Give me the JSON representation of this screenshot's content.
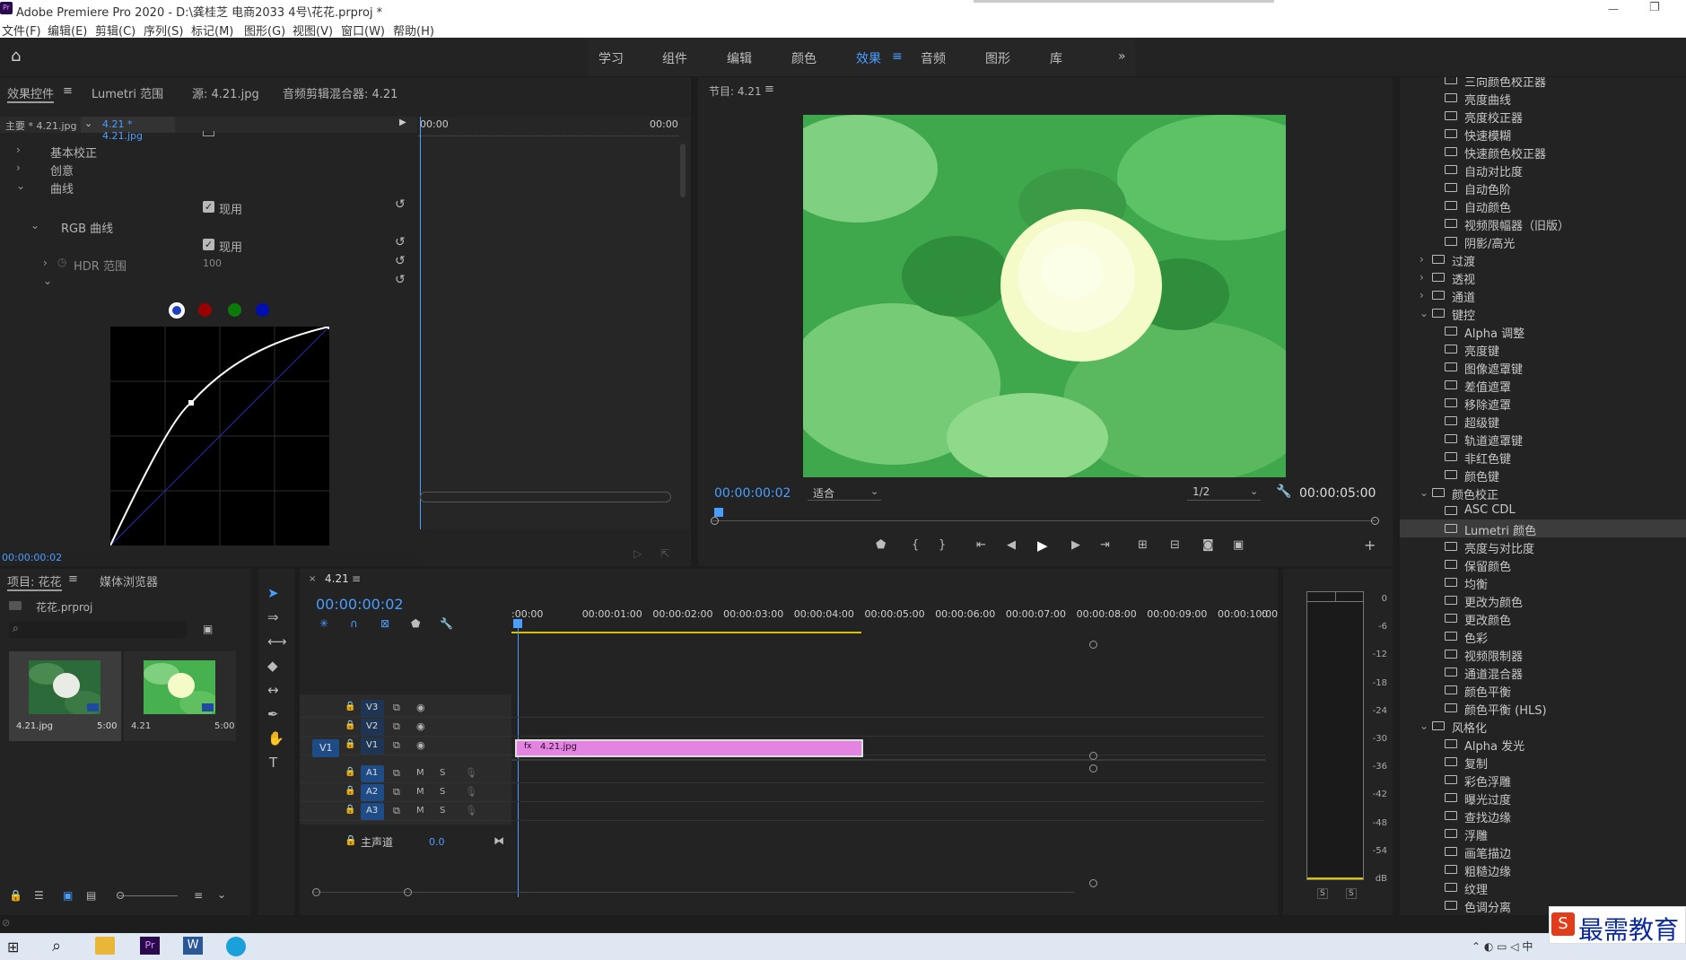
{
  "app": {
    "title": "Adobe Premiere Pro 2020 - D:\\龚桂芝 电商2033 4号\\花花.prproj *",
    "icon": "Pr"
  },
  "menu": [
    "文件(F)",
    "编辑(E)",
    "剪辑(C)",
    "序列(S)",
    "标记(M)",
    "图形(G)",
    "视图(V)",
    "窗口(W)",
    "帮助(H)"
  ],
  "workspaces": {
    "tabs": [
      "学习",
      "组件",
      "编辑",
      "颜色",
      "效果",
      "音频",
      "图形",
      "库"
    ],
    "active": "效果",
    "more": "»"
  },
  "effect_controls": {
    "tabs": [
      "效果控件",
      "Lumetri 范围",
      "源: 4.21.jpg",
      "音频剪辑混合器: 4.21"
    ],
    "master": "主要 * 4.21.jpg",
    "clip": "4.21 * 4.21.jpg",
    "time_start": "00:00",
    "time_end": "00:00",
    "timecode": "00:00:00:02",
    "items": [
      {
        "label": "基本校正"
      },
      {
        "label": "创意"
      },
      {
        "label": "曲线"
      },
      {
        "label": "现用"
      },
      {
        "label": "RGB 曲线"
      },
      {
        "label": "现用"
      },
      {
        "label": "HDR 范围",
        "value": "100"
      }
    ],
    "curve_channels": [
      "white",
      "red",
      "green",
      "blue"
    ]
  },
  "program": {
    "title": "节目: 4.21",
    "timecode": "00:00:00:02",
    "fit": "适合",
    "resolution": "1/2",
    "duration": "00:00:05:00"
  },
  "effects_panel": {
    "items_top": [
      "三向颜色校正器",
      "亮度曲线",
      "亮度校正器",
      "快速模糊",
      "快速颜色校正器",
      "自动对比度",
      "自动色阶",
      "自动颜色",
      "视频限幅器（旧版）",
      "阴影/高光"
    ],
    "folders1": [
      "过渡",
      "透视",
      "通道"
    ],
    "key_folder": "键控",
    "key_items": [
      "Alpha 调整",
      "亮度键",
      "图像遮罩键",
      "差值遮罩",
      "移除遮罩",
      "超级键",
      "轨道遮罩键",
      "非红色键",
      "颜色键"
    ],
    "color_folder": "颜色校正",
    "color_items": [
      "ASC CDL",
      "Lumetri 颜色",
      "亮度与对比度",
      "保留颜色",
      "均衡",
      "更改为颜色",
      "更改颜色",
      "色彩",
      "视频限制器",
      "通道混合器",
      "颜色平衡",
      "颜色平衡 (HLS)"
    ],
    "style_folder": "风格化",
    "style_items": [
      "Alpha 发光",
      "复制",
      "彩色浮雕",
      "曝光过度",
      "查找边缘",
      "浮雕",
      "画笔描边",
      "粗糙边缘",
      "纹理",
      "色调分离"
    ],
    "selected": "Lumetri 颜色"
  },
  "project": {
    "tabs": [
      "项目: 花花",
      "媒体浏览器"
    ],
    "file": "花花.prproj",
    "clips": [
      {
        "name": "4.21.jpg",
        "duration": "5:00"
      },
      {
        "name": "4.21",
        "duration": "5:00"
      }
    ]
  },
  "timeline": {
    "title": "4.21",
    "timecode": "00:00:00:02",
    "ruler": [
      ":00:00",
      "00:00:01:00",
      "00:00:02:00",
      "00:00:03:00",
      "00:00:04:00",
      "00:00:05:00",
      "00:00:06:00",
      "00:00:07:00",
      "00:00:08:00",
      "00:00:09:00",
      "00:00:10:00",
      "0"
    ],
    "video_tracks": [
      "V3",
      "V2",
      "V1"
    ],
    "audio_tracks": [
      "A1",
      "A2",
      "A3"
    ],
    "source_v": "V1",
    "master": "主声道",
    "master_value": "0.0",
    "clip": "4.21.jpg",
    "m": "M",
    "s": "S"
  },
  "meter": {
    "labels": [
      "0",
      "-6",
      "-12",
      "-18",
      "-24",
      "-30",
      "-36",
      "-42",
      "-48",
      "-54",
      "dB"
    ],
    "s": "S"
  },
  "colors": {
    "accent": "#4a9eff",
    "clip": "#e284e0",
    "sel": "#3c3c3c"
  },
  "watermark": "最需教育"
}
